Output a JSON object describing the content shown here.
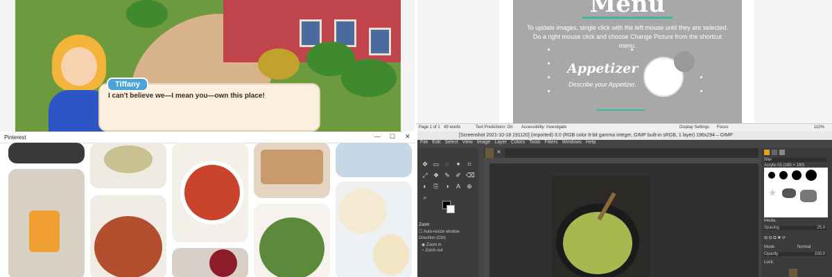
{
  "game": {
    "speaker": "Tiffany",
    "dialog": "I can't believe we—I mean you—own this place!"
  },
  "word": {
    "menu_title": "Menu",
    "instructions": "To update images, single click with the left mouse until they are selected.  Do a right mouse click and choose Change Picture from the shortcut menu.",
    "appetizer": "Appetizer",
    "describe": "Describe your Appetizer.",
    "status": {
      "page": "Page 1 of 1",
      "words": "49 words",
      "predictions": "Text Predictions: On",
      "accessibility": "Accessibility: Investigate",
      "display": "Display Settings",
      "focus": "Focus",
      "zoom": "110%"
    }
  },
  "pinterest": {
    "window_title": "Pinterest",
    "min": "—",
    "max": "☐",
    "close": "✕"
  },
  "gimp": {
    "title": "[Screenshot 2021-10-18 191120] (imported)-3.0 (RGB color 8-bit gamma integer, GIMP built-in sRGB, 1 layer) 196x294 – GIMP",
    "menu": [
      "File",
      "Edit",
      "Select",
      "View",
      "Image",
      "Layer",
      "Colors",
      "Tools",
      "Filters",
      "Windows",
      "Help"
    ],
    "tool_options": {
      "title": "Zoom",
      "auto_resize": "Auto-resize window",
      "direction": "Direction  (Ctrl)",
      "zoom_in": "Zoom in",
      "zoom_out": "Zoom out"
    },
    "dock": {
      "filter": "filter",
      "brush_name": "Acrylic 01 (180 × 180)",
      "tag": "Media,",
      "spacing_label": "Spacing",
      "spacing_value": "25.0",
      "mode_label": "Mode",
      "mode_value": "Normal",
      "opacity_label": "Opacity",
      "opacity_value": "100.0",
      "lock_label": "Lock:"
    }
  },
  "colors": {
    "gimp_bg": "#454545",
    "menu_card": "#a8a8a8",
    "accent_teal": "#3fb8a0",
    "tag_blue": "#4ba4d9"
  }
}
